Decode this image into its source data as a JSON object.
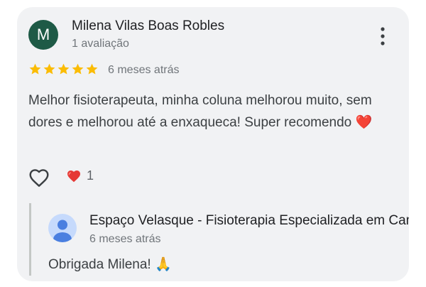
{
  "review": {
    "author_initial": "M",
    "author_name": "Milena Vilas Boas Robles",
    "author_meta": "1 avaliação",
    "rating": 5,
    "max_rating": 5,
    "age": "6 meses atrás",
    "text": "Melhor fisioterapeuta, minha coluna melhorou muito, sem dores e melhorou até a enxaqueca! Super recomendo",
    "text_emoji": "❤️",
    "reaction_emoji": "❤️",
    "reaction_count": "1",
    "avatar_color": "#1e5a46",
    "star_color": "#fbbc04"
  },
  "reply": {
    "author_name": "Espaço Velasque - Fisioterapia Especializada em Campinas",
    "age": "6 meses atrás",
    "text": "Obrigada Milena! 🙏"
  },
  "icons": {
    "menu": "more-vert-icon",
    "like": "heart-outline-icon",
    "reaction": "heart-icon",
    "reply_avatar": "default-user-avatar-icon"
  }
}
